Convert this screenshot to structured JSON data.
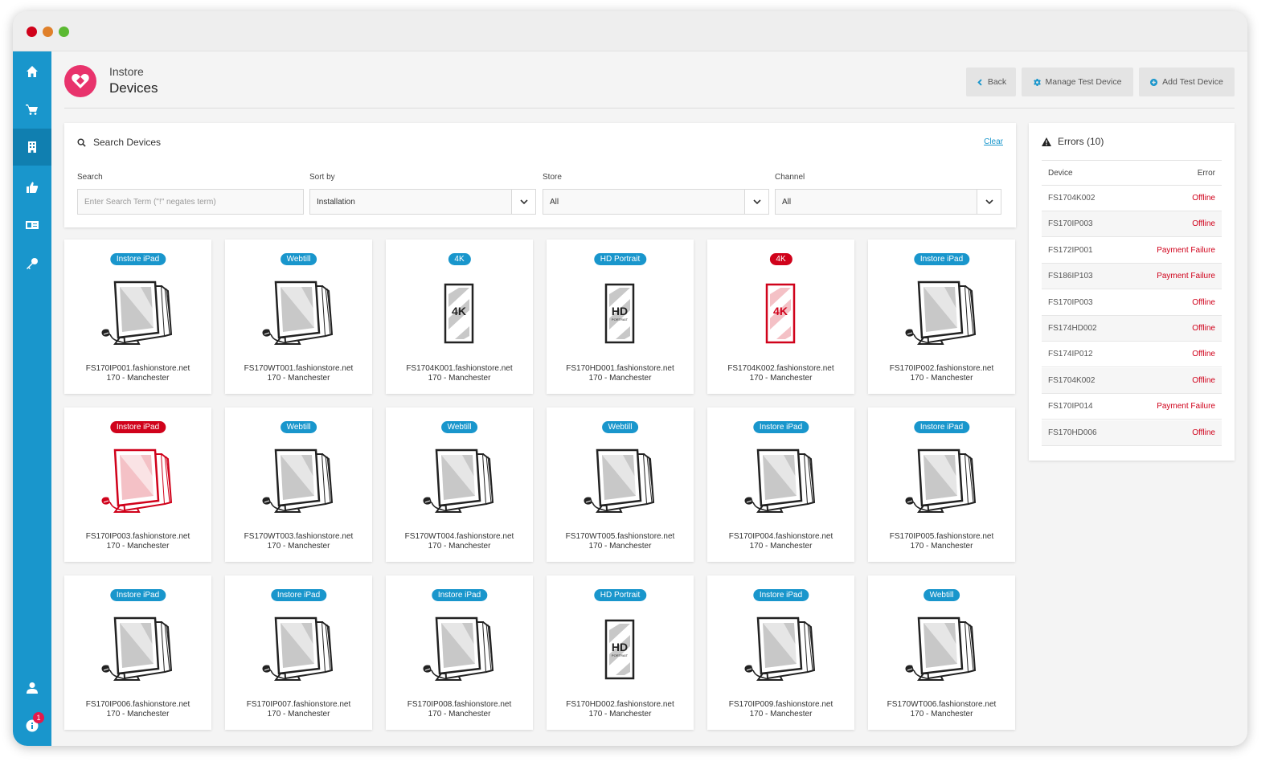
{
  "app": {
    "name": "Instore",
    "page_title": "Devices"
  },
  "header_buttons": {
    "back": "Back",
    "manage": "Manage Test Device",
    "add": "Add Test Device"
  },
  "sidebar": {
    "notification_count": "1"
  },
  "search": {
    "title": "Search Devices",
    "clear": "Clear",
    "search_label": "Search",
    "search_placeholder": "Enter Search Term (\"!\" negates term)",
    "sort_label": "Sort by",
    "sort_value": "Installation",
    "store_label": "Store",
    "store_value": "All",
    "channel_label": "Channel",
    "channel_value": "All"
  },
  "devices": [
    {
      "badge": "Instore iPad",
      "type": "ipad",
      "host": "FS170IP001.fashionstore.net",
      "store": "170 - Manchester",
      "error": false
    },
    {
      "badge": "Webtill",
      "type": "ipad",
      "host": "FS170WT001.fashionstore.net",
      "store": "170 - Manchester",
      "error": false
    },
    {
      "badge": "4K",
      "type": "4k",
      "host": "FS1704K001.fashionstore.net",
      "store": "170 - Manchester",
      "error": false
    },
    {
      "badge": "HD Portrait",
      "type": "hd",
      "host": "FS170HD001.fashionstore.net",
      "store": "170 - Manchester",
      "error": false
    },
    {
      "badge": "4K",
      "type": "4k",
      "host": "FS1704K002.fashionstore.net",
      "store": "170 - Manchester",
      "error": true
    },
    {
      "badge": "Instore iPad",
      "type": "ipad",
      "host": "FS170IP002.fashionstore.net",
      "store": "170 - Manchester",
      "error": false
    },
    {
      "badge": "Instore iPad",
      "type": "ipad",
      "host": "FS170IP003.fashionstore.net",
      "store": "170 - Manchester",
      "error": true
    },
    {
      "badge": "Webtill",
      "type": "ipad",
      "host": "FS170WT003.fashionstore.net",
      "store": "170 - Manchester",
      "error": false
    },
    {
      "badge": "Webtill",
      "type": "ipad",
      "host": "FS170WT004.fashionstore.net",
      "store": "170 - Manchester",
      "error": false
    },
    {
      "badge": "Webtill",
      "type": "ipad",
      "host": "FS170WT005.fashionstore.net",
      "store": "170 - Manchester",
      "error": false
    },
    {
      "badge": "Instore iPad",
      "type": "ipad",
      "host": "FS170IP004.fashionstore.net",
      "store": "170 - Manchester",
      "error": false
    },
    {
      "badge": "Instore iPad",
      "type": "ipad",
      "host": "FS170IP005.fashionstore.net",
      "store": "170 - Manchester",
      "error": false
    },
    {
      "badge": "Instore iPad",
      "type": "ipad",
      "host": "FS170IP006.fashionstore.net",
      "store": "170 - Manchester",
      "error": false
    },
    {
      "badge": "Instore iPad",
      "type": "ipad",
      "host": "FS170IP007.fashionstore.net",
      "store": "170 - Manchester",
      "error": false
    },
    {
      "badge": "Instore iPad",
      "type": "ipad",
      "host": "FS170IP008.fashionstore.net",
      "store": "170 - Manchester",
      "error": false
    },
    {
      "badge": "HD Portrait",
      "type": "hd",
      "host": "FS170HD002.fashionstore.net",
      "store": "170 - Manchester",
      "error": false
    },
    {
      "badge": "Instore iPad",
      "type": "ipad",
      "host": "FS170IP009.fashionstore.net",
      "store": "170 - Manchester",
      "error": false
    },
    {
      "badge": "Webtill",
      "type": "ipad",
      "host": "FS170WT006.fashionstore.net",
      "store": "170 - Manchester",
      "error": false
    }
  ],
  "errors": {
    "title": "Errors (10)",
    "col_device": "Device",
    "col_error": "Error",
    "rows": [
      {
        "device": "FS1704K002",
        "error": "Offline"
      },
      {
        "device": "FS170IP003",
        "error": "Offline"
      },
      {
        "device": "FS172IP001",
        "error": "Payment Failure"
      },
      {
        "device": "FS186IP103",
        "error": "Payment Failure"
      },
      {
        "device": "FS170IP003",
        "error": "Offline"
      },
      {
        "device": "FS174HD002",
        "error": "Offline"
      },
      {
        "device": "FS174IP012",
        "error": "Offline"
      },
      {
        "device": "FS1704K002",
        "error": "Offline"
      },
      {
        "device": "FS170IP014",
        "error": "Payment Failure"
      },
      {
        "device": "FS170HD006",
        "error": "Offline"
      }
    ]
  },
  "colors": {
    "accent": "#1996cc",
    "error": "#d0021b",
    "brand": "#e8336c"
  },
  "icons": {
    "nav": [
      "home-icon",
      "cart-icon",
      "building-icon",
      "thumbs-up-icon",
      "id-card-icon",
      "key-icon"
    ],
    "bottom": [
      "user-icon",
      "info-icon"
    ]
  }
}
